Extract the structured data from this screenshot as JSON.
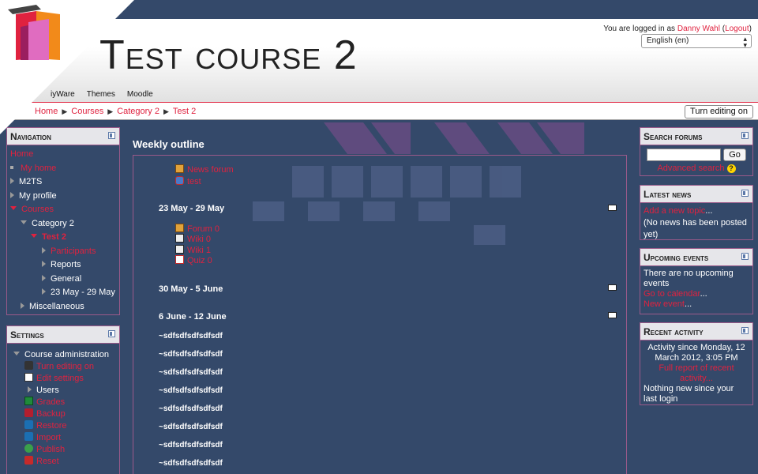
{
  "header": {
    "title": "Test course 2",
    "login_prefix": "You are logged in as",
    "user": "Danny Wahl",
    "logout": "Logout",
    "language": "English (en)",
    "menu": [
      "iyWare",
      "Themes",
      "Moodle"
    ]
  },
  "breadcrumb": [
    "Home",
    "Courses",
    "Category 2",
    "Test 2"
  ],
  "edit_button": "Turn editing on",
  "navigation": {
    "title": "Navigation",
    "items": [
      "Home",
      "My home",
      "M2TS",
      "My profile",
      "Courses",
      "Category 2",
      "Test 2",
      "Participants",
      "Reports",
      "General",
      "23 May - 29 May",
      "Miscellaneous"
    ]
  },
  "settings": {
    "title": "Settings",
    "items": [
      "Course administration",
      "Turn editing on",
      "Edit settings",
      "Users",
      "Grades",
      "Backup",
      "Restore",
      "Import",
      "Publish",
      "Reset"
    ]
  },
  "main": {
    "title": "Weekly outline",
    "intro_activities": [
      "News forum",
      "test"
    ],
    "weeks": [
      {
        "name": "23 May - 29 May",
        "activities": [
          "Forum 0",
          "Wiki 0",
          "Wiki 1",
          "Quiz 0"
        ]
      },
      {
        "name": "30 May - 5 June",
        "activities": []
      },
      {
        "name": "6 June - 12 June",
        "activities": []
      }
    ],
    "sections": [
      "~sdfsdfsdfsdfsdf",
      "~sdfsdfsdfsdfsdf",
      "~sdfsdfsdfsdfsdf",
      "~sdfsdfsdfsdfsdf",
      "~sdfsdfsdfsdfsdf",
      "~sdfsdfsdfsdfsdf",
      "~sdfsdfsdfsdfsdf",
      "~sdfsdfsdfsdfsdf"
    ]
  },
  "search_forums": {
    "title": "Search forums",
    "go": "Go",
    "advanced": "Advanced search"
  },
  "latest_news": {
    "title": "Latest news",
    "add": "Add a new topic",
    "add_suffix": "...",
    "empty": "(No news has been posted yet)"
  },
  "upcoming": {
    "title": "Upcoming events",
    "empty": "There are no upcoming events",
    "calendar": "Go to calendar",
    "new_event": "New event",
    "ellipsis": "..."
  },
  "recent": {
    "title": "Recent activity",
    "since": "Activity since Monday, 12 March 2012, 3:05 PM",
    "full": "Full report of recent activity...",
    "none": "Nothing new since your last login"
  },
  "colors": {
    "accent": "#e0223f",
    "background": "#34496a",
    "border": "#9b5a8a"
  }
}
